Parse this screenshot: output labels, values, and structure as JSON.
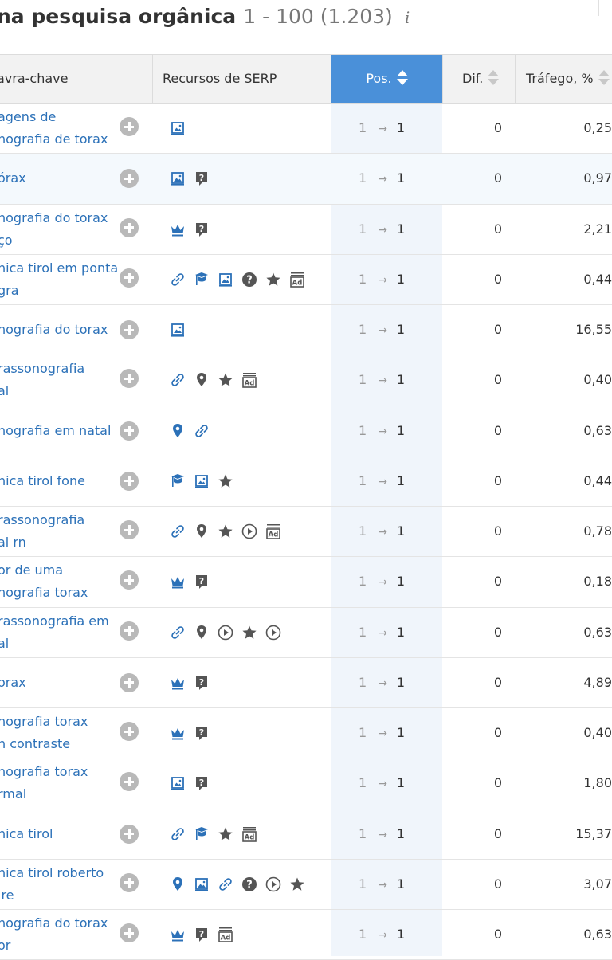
{
  "title": {
    "main": "na pesquisa orgânica",
    "count": "1 - 100 (1.203)",
    "info_glyph": "i"
  },
  "columns": {
    "keyword": "avra-chave",
    "serp": "Recursos de SERP",
    "pos": "Pos.",
    "dif": "Dif.",
    "traffic": "Tráfego, %"
  },
  "colors": {
    "link": "#2c71b8",
    "accent": "#4a90d9",
    "icon": "#2c71b8",
    "icon_dark": "#555555",
    "header_bg": "#f2f2f2"
  },
  "rows": [
    {
      "kw1": "agens de",
      "kw2": "nografia de torax",
      "serp": [
        "image"
      ],
      "prev": "1",
      "cur": "1",
      "dif": "0",
      "traffic": "0,25"
    },
    {
      "kw1": "órax",
      "kw2": "",
      "serp": [
        "image",
        "faq"
      ],
      "prev": "1",
      "cur": "1",
      "dif": "0",
      "traffic": "0,97"
    },
    {
      "kw1": "nografia do torax",
      "kw2": "ço",
      "serp": [
        "crown",
        "faq"
      ],
      "prev": "1",
      "cur": "1",
      "dif": "0",
      "traffic": "2,21"
    },
    {
      "kw1": "nica tirol em ponta",
      "kw2": "gra",
      "serp": [
        "link",
        "academic",
        "image",
        "question",
        "star",
        "ad"
      ],
      "prev": "1",
      "cur": "1",
      "dif": "0",
      "traffic": "0,44"
    },
    {
      "kw1": "nografia do torax",
      "kw2": "",
      "serp": [
        "image"
      ],
      "prev": "1",
      "cur": "1",
      "dif": "0",
      "traffic": "16,55"
    },
    {
      "kw1": "rassonografia",
      "kw2": "al",
      "serp": [
        "link",
        "pin",
        "star",
        "ad"
      ],
      "prev": "1",
      "cur": "1",
      "dif": "0",
      "traffic": "0,40"
    },
    {
      "kw1": "nografia em natal",
      "kw2": "",
      "serp": [
        "pin-blue",
        "link"
      ],
      "prev": "1",
      "cur": "1",
      "dif": "0",
      "traffic": "0,63"
    },
    {
      "kw1": "nica tirol fone",
      "kw2": "",
      "serp": [
        "academic",
        "image",
        "star"
      ],
      "prev": "1",
      "cur": "1",
      "dif": "0",
      "traffic": "0,44"
    },
    {
      "kw1": "rassonografia",
      "kw2": "al rn",
      "serp": [
        "link",
        "pin",
        "star",
        "video",
        "ad"
      ],
      "prev": "1",
      "cur": "1",
      "dif": "0",
      "traffic": "0,78"
    },
    {
      "kw1": "or de uma",
      "kw2": "nografia torax",
      "serp": [
        "crown",
        "faq"
      ],
      "prev": "1",
      "cur": "1",
      "dif": "0",
      "traffic": "0,18"
    },
    {
      "kw1": "rassonografia em",
      "kw2": "al",
      "serp": [
        "link",
        "pin",
        "video",
        "star",
        "video"
      ],
      "prev": "1",
      "cur": "1",
      "dif": "0",
      "traffic": "0,63"
    },
    {
      "kw1": "orax",
      "kw2": "",
      "serp": [
        "crown",
        "faq"
      ],
      "prev": "1",
      "cur": "1",
      "dif": "0",
      "traffic": "4,89"
    },
    {
      "kw1": "nografia torax",
      "kw2": "n contraste",
      "serp": [
        "crown",
        "faq"
      ],
      "prev": "1",
      "cur": "1",
      "dif": "0",
      "traffic": "0,40"
    },
    {
      "kw1": "nografia torax",
      "kw2": "rmal",
      "serp": [
        "image",
        "faq"
      ],
      "prev": "1",
      "cur": "1",
      "dif": "0",
      "traffic": "1,80"
    },
    {
      "kw1": "nica tirol",
      "kw2": "",
      "serp": [
        "link",
        "academic",
        "star",
        "ad"
      ],
      "prev": "1",
      "cur": "1",
      "dif": "0",
      "traffic": "15,37"
    },
    {
      "kw1": "nica tirol roberto",
      "kw2": "ire",
      "serp": [
        "pin-blue",
        "image",
        "link",
        "question",
        "video",
        "star"
      ],
      "prev": "1",
      "cur": "1",
      "dif": "0",
      "traffic": "3,07"
    },
    {
      "kw1": "nografia do torax",
      "kw2": "or",
      "serp": [
        "crown",
        "faq",
        "ad"
      ],
      "prev": "1",
      "cur": "1",
      "dif": "0",
      "traffic": "0,63"
    }
  ]
}
